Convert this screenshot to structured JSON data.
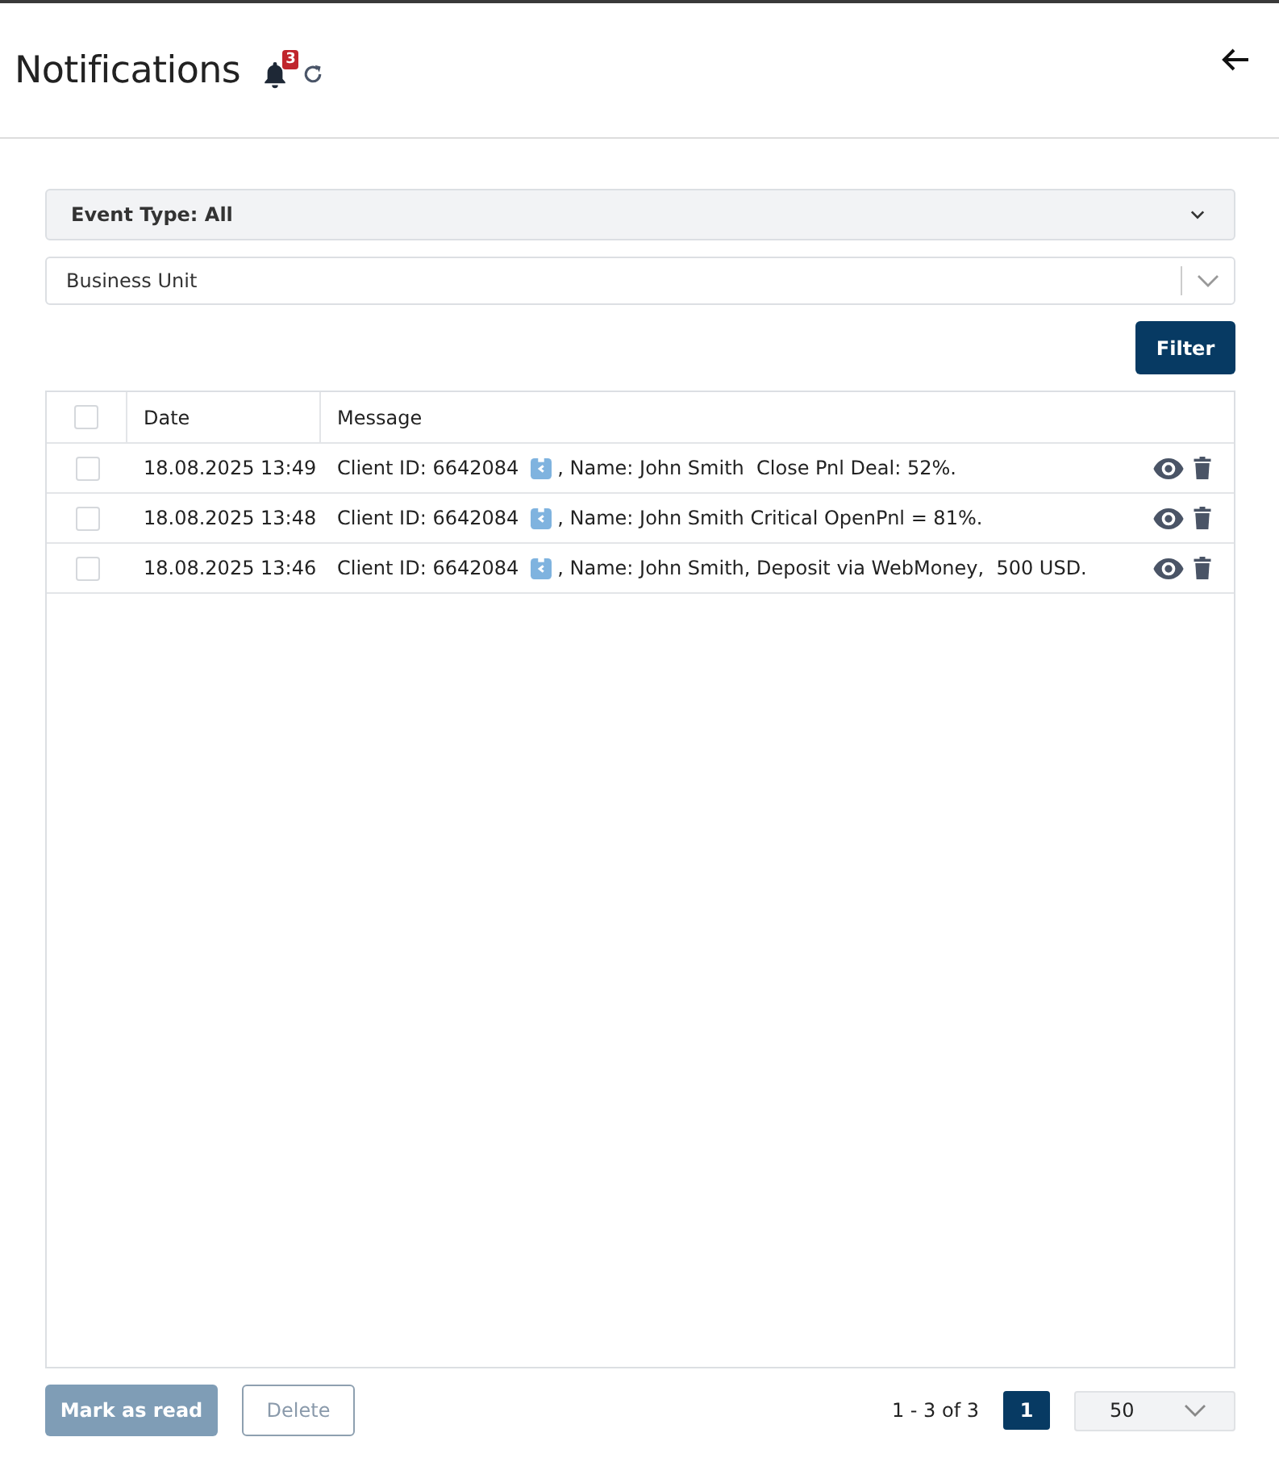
{
  "header": {
    "title": "Notifications",
    "badge": "3"
  },
  "filters": {
    "event_type": "Event Type: All",
    "business_unit": {
      "placeholder": "Business Unit"
    },
    "filter_button": "Filter"
  },
  "table": {
    "columns": [
      "Date",
      "Message"
    ],
    "all_checked": false,
    "rows": [
      {
        "checked": false,
        "date": "18.08.2025 13:49",
        "client": "Client ID: 6642084",
        "message": ", Name: John Smith  Close Pnl Deal: 52%."
      },
      {
        "checked": false,
        "date": "18.08.2025 13:48",
        "client": "Client ID: 6642084",
        "message": ", Name: John Smith Critical OpenPnl = 81%."
      },
      {
        "checked": false,
        "date": "18.08.2025 13:46",
        "client": "Client ID: 6642084",
        "message": ", Name: John Smith, Deposit via WebMoney,  500 USD."
      }
    ]
  },
  "footer": {
    "buttons": [
      {
        "label": "Mark as read",
        "kind": "primary",
        "disabled": true
      },
      {
        "label": "Delete",
        "kind": "outline",
        "disabled": true
      }
    ],
    "range": "1 - 3 of 3",
    "pages": [
      {
        "label": "1",
        "selected": true
      }
    ],
    "page_size": "50"
  }
}
